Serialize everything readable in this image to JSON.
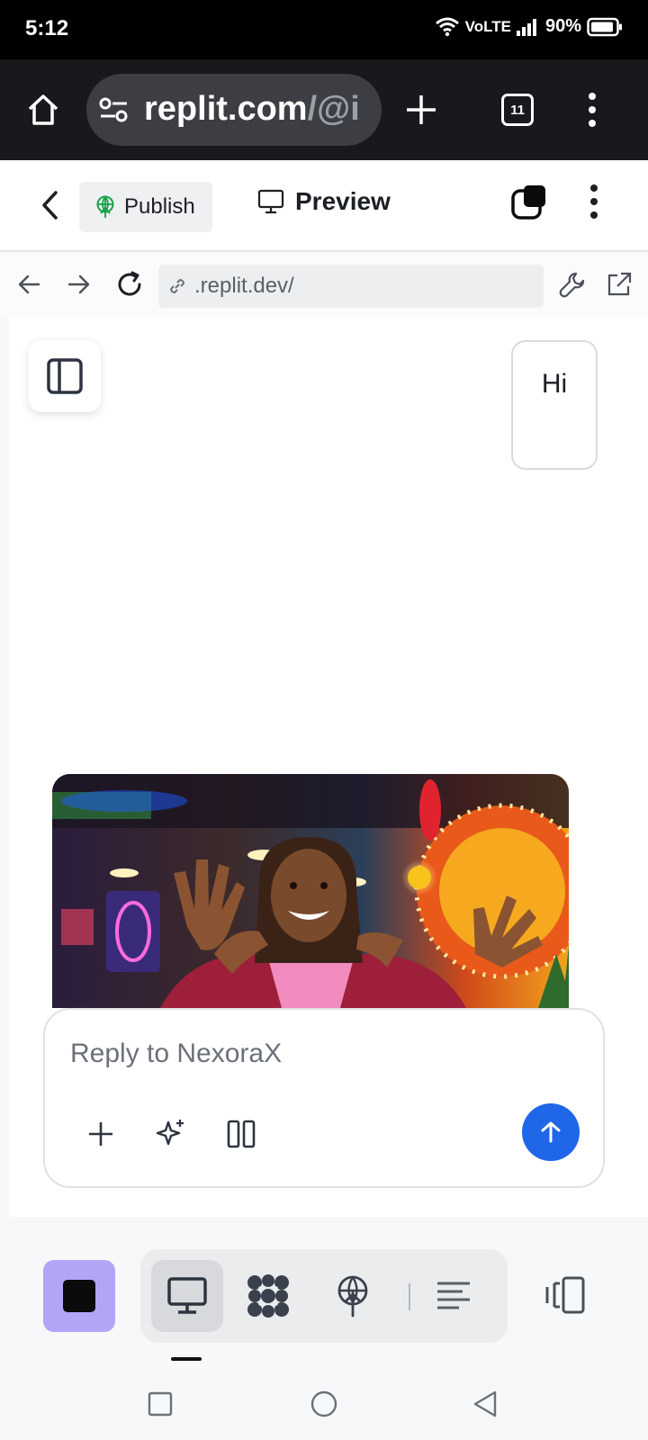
{
  "status_bar": {
    "time": "5:12",
    "network": "VoLTE",
    "battery": "90%",
    "battery_level": 0.9
  },
  "browser": {
    "url_main": "replit.com",
    "url_rest": "/@i",
    "tab_count": "11"
  },
  "replit_header": {
    "publish_label": "Publish",
    "preview_label": "Preview"
  },
  "preview_address": {
    "url": ".replit.dev/"
  },
  "chat": {
    "user_message": "Hi",
    "composer_placeholder": "Reply to NexoraX"
  },
  "colors": {
    "send_button": "#1f66e8",
    "stop_button": "#b3a4f7",
    "publish_icon": "#16a34a"
  },
  "icons": {
    "browser": [
      "home-icon",
      "site-settings-icon",
      "new-tab-icon",
      "tab-switcher-icon",
      "menu-icon"
    ],
    "header": [
      "back-icon",
      "publish-icon",
      "monitor-icon",
      "devtools-icon",
      "more-icon"
    ],
    "address": [
      "back-arrow-icon",
      "forward-arrow-icon",
      "reload-icon",
      "link-icon",
      "wrench-icon",
      "open-external-icon"
    ],
    "composer": [
      "plus-icon",
      "sparkle-icon",
      "columns-icon",
      "arrow-up-icon"
    ],
    "toolbar": [
      "stop-icon",
      "monitor-icon",
      "workspace-icon",
      "publish-icon",
      "console-icon",
      "layout-icon"
    ],
    "system_nav": [
      "recents-icon",
      "home-circle-icon",
      "back-triangle-icon"
    ]
  }
}
